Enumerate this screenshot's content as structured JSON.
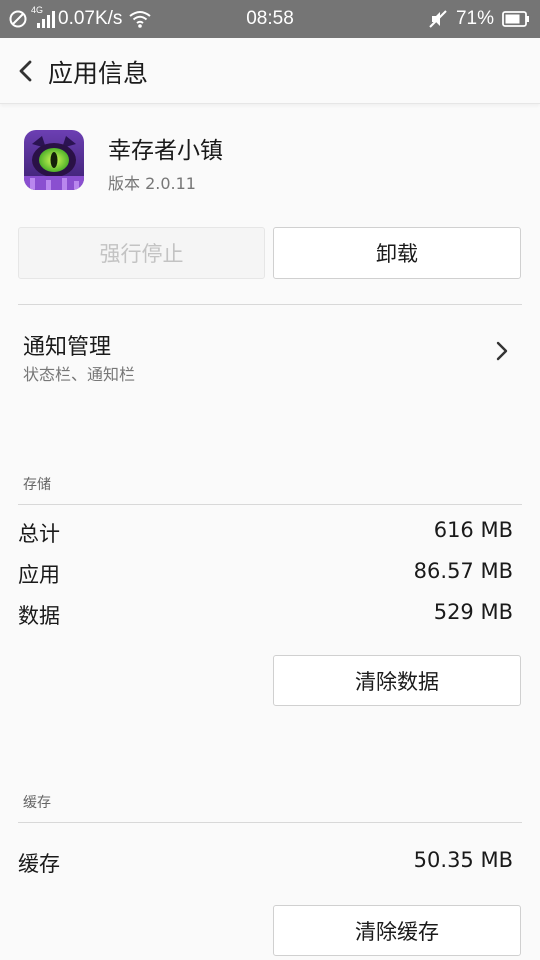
{
  "status_bar": {
    "network_speed": "0.07K/s",
    "network_type": "4G",
    "time": "08:58",
    "battery": "71%",
    "icons": [
      "dnd-icon",
      "signal-icon",
      "wifi-icon",
      "mute-icon",
      "battery-icon"
    ]
  },
  "header": {
    "title": "应用信息",
    "back_icon": "chevron-left-icon"
  },
  "app": {
    "name": "幸存者小镇",
    "version": "版本 2.0.11",
    "icon": "monster-eye-app-icon"
  },
  "actions": {
    "force_stop": "强行停止",
    "uninstall": "卸载"
  },
  "notification": {
    "title": "通知管理",
    "subtitle": "状态栏、通知栏"
  },
  "storage": {
    "section_title": "存储",
    "rows": [
      {
        "label": "总计",
        "value": "616 MB"
      },
      {
        "label": "应用",
        "value": "86.57 MB"
      },
      {
        "label": "数据",
        "value": "529 MB"
      }
    ],
    "clear_data": "清除数据"
  },
  "cache": {
    "section_title": "缓存",
    "rows": [
      {
        "label": "缓存",
        "value": "50.35 MB"
      }
    ],
    "clear_cache": "清除缓存"
  },
  "colors": {
    "status_bar_bg": "#757575",
    "page_bg": "#fafafa",
    "disabled_text": "#c3c3c3",
    "divider": "#d8d8d8"
  }
}
